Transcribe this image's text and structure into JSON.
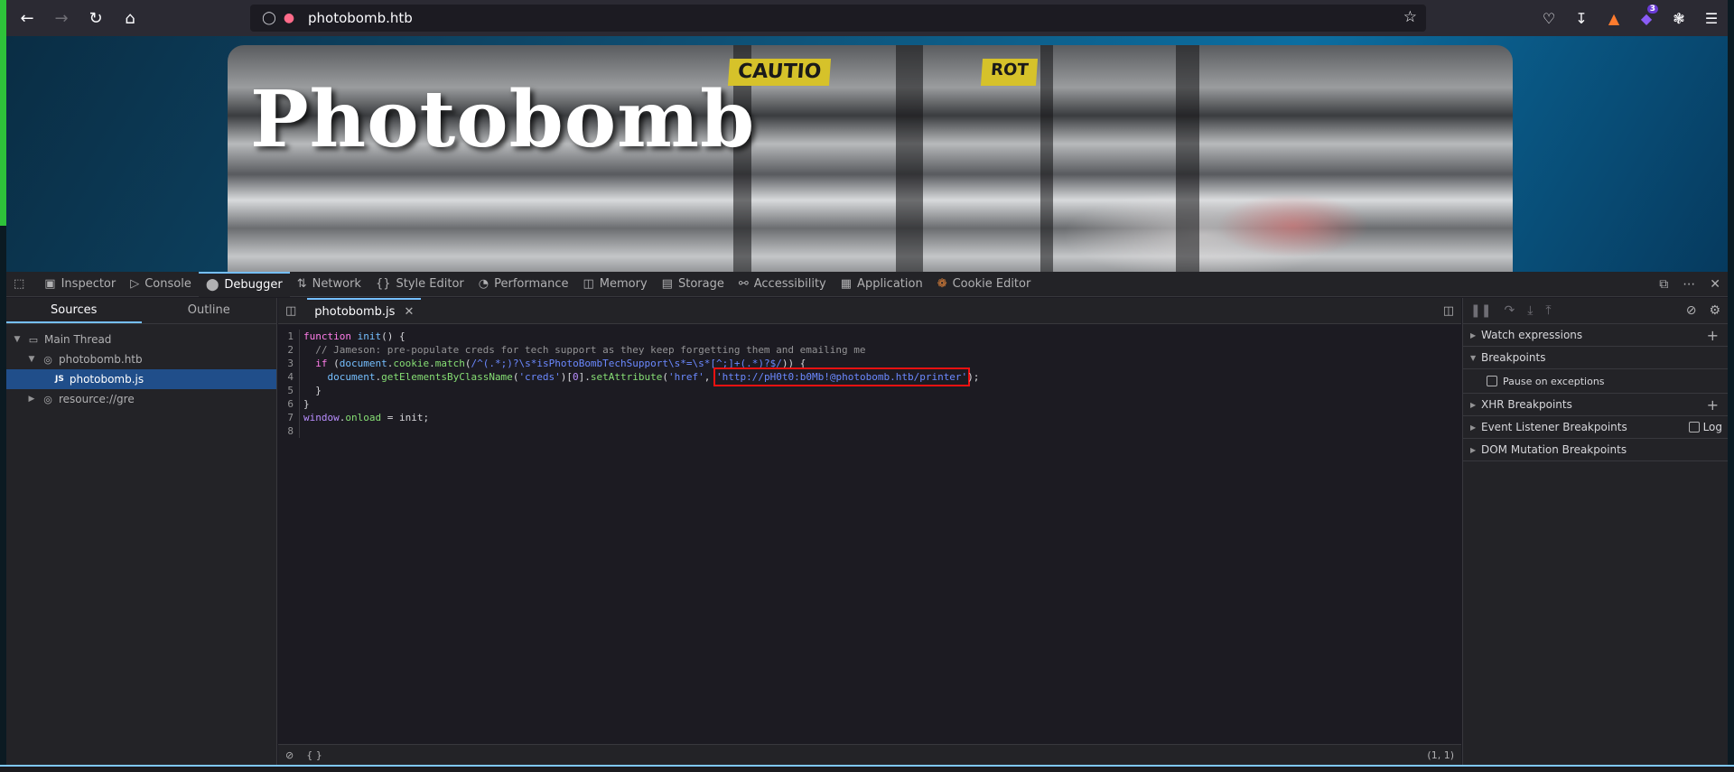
{
  "browser": {
    "url": "photobomb.htb",
    "extension_badge": "3"
  },
  "page": {
    "title": "Photobomb",
    "sign_text_1": "CAUTIO",
    "sign_text_2": "ROT"
  },
  "devtools": {
    "tabs": [
      {
        "label": "Inspector",
        "icon": "inspector-icon"
      },
      {
        "label": "Console",
        "icon": "console-icon"
      },
      {
        "label": "Debugger",
        "icon": "debugger-icon",
        "active": true
      },
      {
        "label": "Network",
        "icon": "network-icon"
      },
      {
        "label": "Style Editor",
        "icon": "braces-icon"
      },
      {
        "label": "Performance",
        "icon": "gauge-icon"
      },
      {
        "label": "Memory",
        "icon": "memory-icon"
      },
      {
        "label": "Storage",
        "icon": "storage-icon"
      },
      {
        "label": "Accessibility",
        "icon": "accessibility-icon"
      },
      {
        "label": "Application",
        "icon": "grid-icon"
      },
      {
        "label": "Cookie Editor",
        "icon": "cookie-icon"
      }
    ],
    "sources": {
      "subtabs": [
        "Sources",
        "Outline"
      ],
      "tree": [
        {
          "label": "Main Thread"
        },
        {
          "label": "photobomb.htb"
        },
        {
          "label": "photobomb.js",
          "badge": "JS"
        },
        {
          "label": "resource://gre"
        }
      ]
    },
    "editor": {
      "tab_label": "photobomb.js",
      "line_numbers": [
        "1",
        "2",
        "3",
        "4",
        "5",
        "6",
        "7",
        "8"
      ],
      "code": {
        "l1_kw": "function",
        "l1_fn": "init",
        "l1_rest": "() {",
        "l2_comment": "  // Jameson: pre-populate creds for tech support as they keep forgetting them and emailing me",
        "l3_kw": "  if",
        "l3_a": " (",
        "l3_doc": "document",
        "l3_b": ".",
        "l3_prop": "cookie",
        "l3_c": ".",
        "l3_fn": "match",
        "l3_d": "(",
        "l3_regex": "/^(.*;)?\\s*isPhotoBombTechSupport\\s*=\\s*[^;]+(.*)?$/",
        "l3_e": ")) {",
        "l4_a": "    ",
        "l4_doc": "document",
        "l4_b": ".",
        "l4_fn1": "getElementsByClassName",
        "l4_c": "(",
        "l4_str1": "'creds'",
        "l4_d": ")[",
        "l4_num": "0",
        "l4_e": "].",
        "l4_fn2": "setAttribute",
        "l4_f": "(",
        "l4_str2": "'href'",
        "l4_g": ", ",
        "l4_str3": "'http://pH0t0:b0Mb!@photobomb.htb/printer'",
        "l4_h": ");",
        "l5": "  }",
        "l6": "}",
        "l7_obj": "window",
        "l7_a": ".",
        "l7_prop": "onload",
        "l7_b": " = ",
        "l7_fn": "init",
        "l7_c": ";"
      },
      "footer_braces": "{ }",
      "cursor_position": "(1, 1)"
    },
    "right_panel": {
      "watch_expressions": "Watch expressions",
      "breakpoints": "Breakpoints",
      "pause_on_exceptions": "Pause on exceptions",
      "xhr_breakpoints": "XHR Breakpoints",
      "event_listener_breakpoints": "Event Listener Breakpoints",
      "log_label": "Log",
      "dom_mutation_breakpoints": "DOM Mutation Breakpoints"
    }
  },
  "colors": {
    "highlight_box": "#ee1111",
    "active_tab_accent": "#75bfff",
    "selected_row": "#204e8a"
  }
}
